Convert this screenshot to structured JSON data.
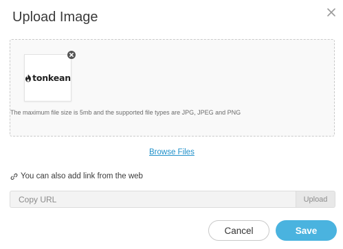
{
  "modal": {
    "title": "Upload Image",
    "close_icon": "close-icon"
  },
  "dropzone": {
    "thumbnail": {
      "logo_text": "tonkean",
      "logo_icon": "tonkean-logo-icon",
      "remove_icon": "remove-circle-icon"
    },
    "hint": "The maximum file size is 5mb and the supported file types are JPG, JPEG and PNG"
  },
  "browse": {
    "label": "Browse Files"
  },
  "web": {
    "icon": "link-icon",
    "label": "You can also add link from the web",
    "url_placeholder": "Copy URL",
    "url_value": "",
    "upload_label": "Upload"
  },
  "actions": {
    "cancel_label": "Cancel",
    "save_label": "Save"
  },
  "colors": {
    "accent": "#4ab3df",
    "link": "#1d8fc9",
    "dropzone_bg": "#f9f9f9",
    "dropzone_border": "#c9c9c9"
  }
}
